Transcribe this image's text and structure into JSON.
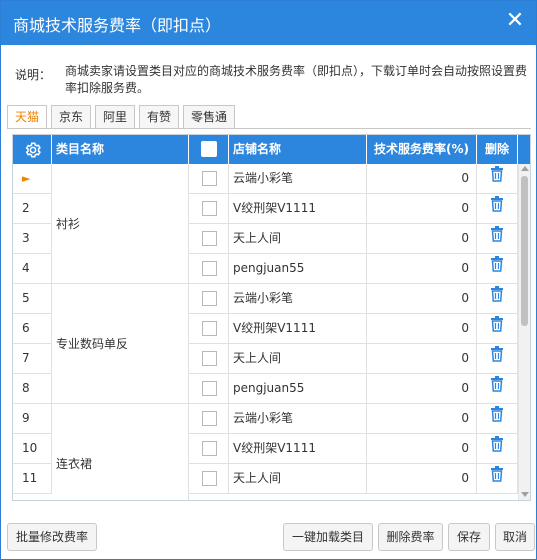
{
  "window": {
    "title": "商城技术服务费率（即扣点）",
    "close_icon": "close-icon"
  },
  "description": {
    "label": "说明：",
    "text": "商城卖家请设置类目对应的商城技术服务费率（即扣点），下载订单时会自动按照设置费率扣除服务费。"
  },
  "tabs": [
    {
      "label": "天猫",
      "active": true
    },
    {
      "label": "京东",
      "active": false
    },
    {
      "label": "阿里",
      "active": false
    },
    {
      "label": "有赞",
      "active": false
    },
    {
      "label": "零售通",
      "active": false
    }
  ],
  "grid": {
    "columns": {
      "settings_icon": "gear-icon",
      "category": "类目名称",
      "shop": "店铺名称",
      "rate": "技术服务费率(%)",
      "delete": "删除"
    },
    "current_row_marker": "►",
    "groups": [
      {
        "category": "衬衫"
      },
      {
        "category": "专业数码单反"
      },
      {
        "category": "连衣裙"
      }
    ],
    "rows": [
      {
        "num": "",
        "shop": "云端小彩笔",
        "rate": "0"
      },
      {
        "num": "2",
        "shop": "V绞刑架V1111",
        "rate": "0"
      },
      {
        "num": "3",
        "shop": "天上人间",
        "rate": "0"
      },
      {
        "num": "4",
        "shop": "pengjuan55",
        "rate": "0"
      },
      {
        "num": "5",
        "shop": "云端小彩笔",
        "rate": "0"
      },
      {
        "num": "6",
        "shop": "V绞刑架V1111",
        "rate": "0"
      },
      {
        "num": "7",
        "shop": "天上人间",
        "rate": "0"
      },
      {
        "num": "8",
        "shop": "pengjuan55",
        "rate": "0"
      },
      {
        "num": "9",
        "shop": "云端小彩笔",
        "rate": "0"
      },
      {
        "num": "10",
        "shop": "V绞刑架V1111",
        "rate": "0"
      },
      {
        "num": "11",
        "shop": "天上人间",
        "rate": "0"
      }
    ]
  },
  "buttons": {
    "batch_edit": "批量修改费率",
    "load_categories": "一键加载类目",
    "delete_rate": "删除费率",
    "save": "保存",
    "cancel": "取消"
  },
  "colors": {
    "accent": "#2d86dd",
    "active_tab": "#f08300",
    "trash": "#2d86dd"
  }
}
